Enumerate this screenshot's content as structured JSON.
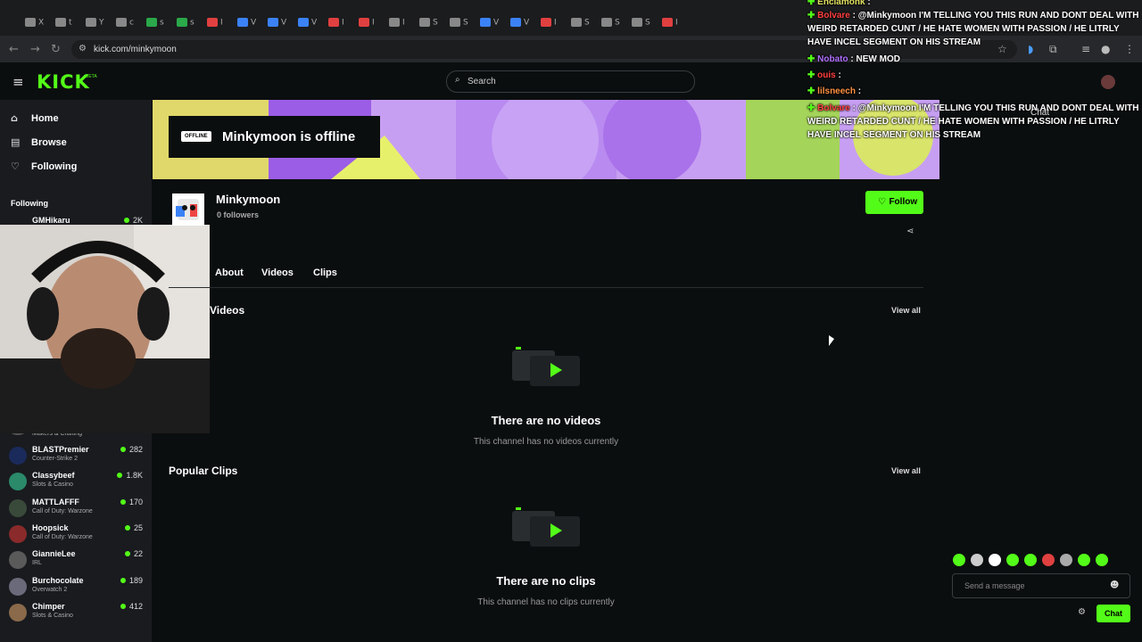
{
  "browser": {
    "url": "kick.com/minkymoon",
    "tabs": [
      "X",
      "t",
      "Y",
      "c",
      "s",
      "s",
      "I",
      "V",
      "V",
      "V",
      "I",
      "I",
      "I",
      "S",
      "S",
      "V",
      "V",
      "I",
      "S",
      "S",
      "S",
      "I"
    ]
  },
  "header": {
    "logo": "KICK",
    "beta": "BETA",
    "search_placeholder": "Search"
  },
  "sidebar": {
    "nav": [
      {
        "label": "Home",
        "icon": "home-icon"
      },
      {
        "label": "Browse",
        "icon": "browse-icon"
      },
      {
        "label": "Following",
        "icon": "heart-icon"
      }
    ],
    "following_title": "Following",
    "top": {
      "name": "GMHikaru",
      "viewers": "2K"
    },
    "partial_category": "Makers & Crafting",
    "channels": [
      {
        "name": "BLASTPremier",
        "category": "Counter-Strike 2",
        "viewers": "282",
        "color": "#1a2a5a"
      },
      {
        "name": "Classybeef",
        "category": "Slots & Casino",
        "viewers": "1.8K",
        "color": "#2a8a6a"
      },
      {
        "name": "MATTLAFFF",
        "category": "Call of Duty: Warzone",
        "viewers": "170",
        "color": "#3a4a3a"
      },
      {
        "name": "Hoopsick",
        "category": "Call of Duty: Warzone",
        "viewers": "25",
        "color": "#8a2a2a"
      },
      {
        "name": "GiannieLee",
        "category": "IRL",
        "viewers": "22",
        "color": "#5a5a5a"
      },
      {
        "name": "Burchocolate",
        "category": "Overwatch 2",
        "viewers": "189",
        "color": "#6a6a7a"
      },
      {
        "name": "Chimper",
        "category": "Slots & Casino",
        "viewers": "412",
        "color": "#8a6a4a"
      }
    ]
  },
  "channel": {
    "offline_tag": "OFFLINE",
    "offline_text": "Minkymoon is offline",
    "name": "Minkymoon",
    "followers": "0 followers",
    "follow_label": "Follow",
    "tabs": [
      "About",
      "Videos",
      "Clips"
    ],
    "videos_title": "Videos",
    "view_all": "View all",
    "no_videos": "There are no videos",
    "no_videos_sub": "This channel has no videos currently",
    "clips_title": "Popular Clips",
    "no_clips": "There are no clips",
    "no_clips_sub": "This channel has no clips currently"
  },
  "chat_overlay": [
    {
      "user": "Enclamonk",
      "user_color": "#e0e060",
      "text": ":"
    },
    {
      "user": "Bolvare",
      "user_color": "#ff4040",
      "text": ": @Minkymoon I'M TELLING YOU THIS RUN AND DONT DEAL WITH WEIRD RETARDED CUNT / HE HATE WOMEN WITH PASSION / HE LITRLY HAVE INCEL SEGMENT ON HIS STREAM"
    },
    {
      "user": "Nobato",
      "user_color": "#b070ff",
      "text": ": NEW MOD"
    },
    {
      "user": "ouis",
      "user_color": "#ff4040",
      "text": ":"
    },
    {
      "user": "lilsneech",
      "user_color": "#ff9040",
      "text": ":"
    },
    {
      "user": "Bolvare",
      "user_color": "#ff4040",
      "text": ": @Minkymoon I'M TELLING YOU THIS RUN AND DONT DEAL WITH WEIRD RETARDED CUNT / HE HATE WOMEN WITH PASSION / HE LITRLY HAVE INCEL SEGMENT ON HIS STREAM"
    }
  ],
  "chat": {
    "header": "Chat",
    "placeholder": "Send a message",
    "send_label": "Chat"
  },
  "colors": {
    "accent": "#53fc18",
    "bg": "#0b0e0f",
    "sidebar": "#191b1f"
  }
}
